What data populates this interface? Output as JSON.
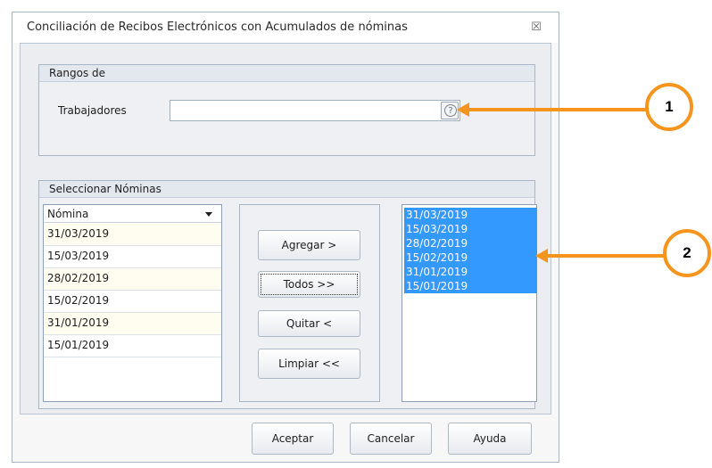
{
  "window": {
    "title": "Conciliación de Recibos Electrónicos con Acumulados de nóminas",
    "close_glyph": "☒"
  },
  "rangos": {
    "title": "Rangos de",
    "trabajadores_label": "Trabajadores",
    "trabajadores_value": "",
    "help_glyph": "?"
  },
  "nominas": {
    "title": "Seleccionar Nóminas",
    "column_header": "Nómina",
    "available": [
      "31/03/2019",
      "15/03/2019",
      "28/02/2019",
      "15/02/2019",
      "31/01/2019",
      "15/01/2019"
    ],
    "buttons": {
      "agregar": "Agregar >",
      "todos": "Todos >>",
      "quitar": "Quitar <",
      "limpiar": "Limpiar <<"
    },
    "selected": [
      "31/03/2019",
      "15/03/2019",
      "28/02/2019",
      "15/02/2019",
      "31/01/2019",
      "15/01/2019"
    ]
  },
  "footer": {
    "aceptar": "Aceptar",
    "cancelar": "Cancelar",
    "ayuda": "Ayuda"
  },
  "annotations": {
    "callout_1": "1",
    "callout_2": "2",
    "color": "#f7941d"
  }
}
